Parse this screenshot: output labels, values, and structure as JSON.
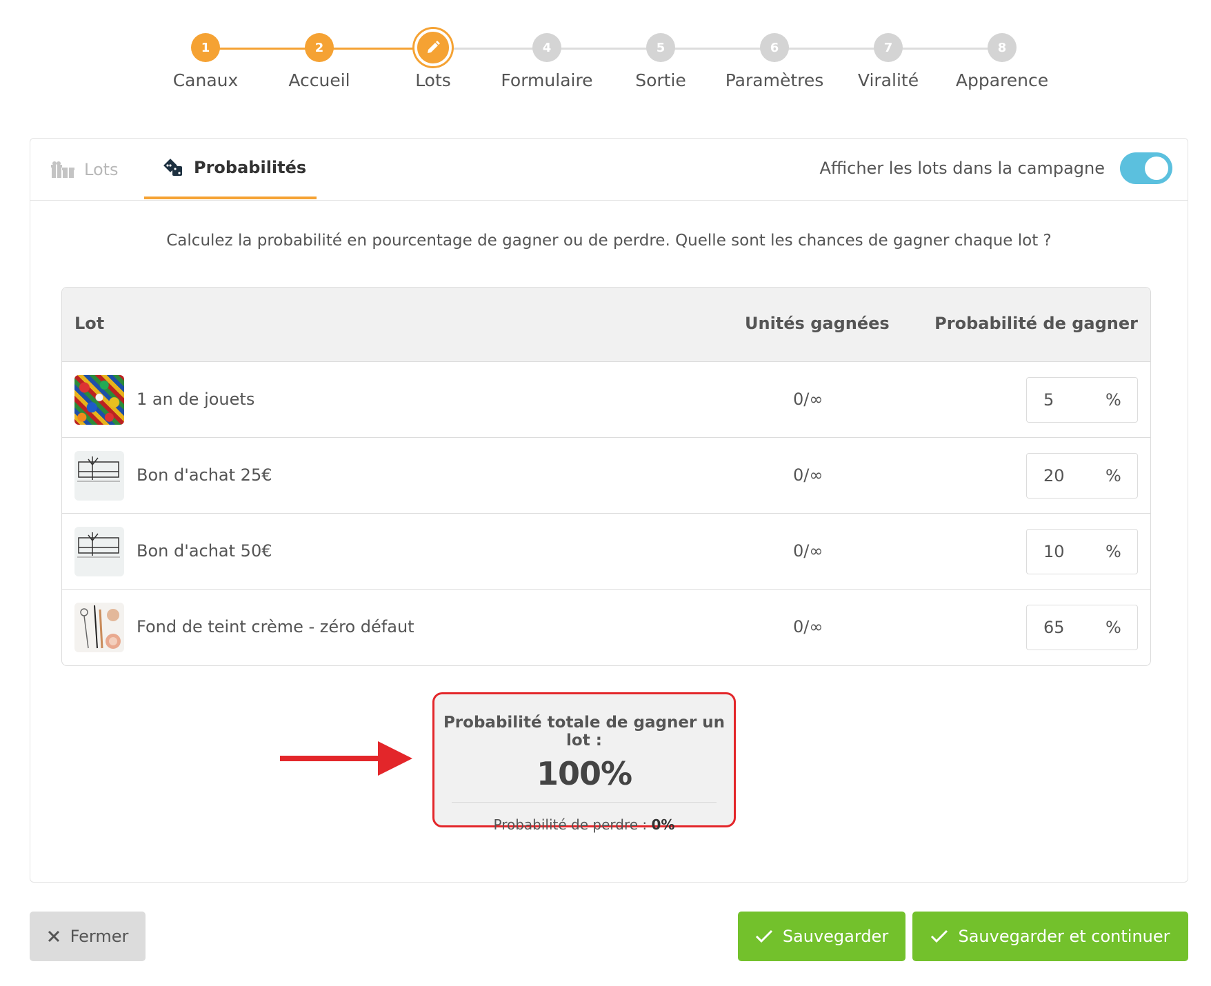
{
  "stepper": {
    "steps": [
      {
        "number": "1",
        "label": "Canaux",
        "state": "done"
      },
      {
        "number": "2",
        "label": "Accueil",
        "state": "done"
      },
      {
        "number": "",
        "label": "Lots",
        "state": "current",
        "icon": "pencil-icon"
      },
      {
        "number": "4",
        "label": "Formulaire",
        "state": "todo"
      },
      {
        "number": "5",
        "label": "Sortie",
        "state": "todo"
      },
      {
        "number": "6",
        "label": "Paramètres",
        "state": "todo"
      },
      {
        "number": "7",
        "label": "Viralité",
        "state": "todo"
      },
      {
        "number": "8",
        "label": "Apparence",
        "state": "todo"
      }
    ]
  },
  "tabs": {
    "lots": {
      "label": "Lots",
      "icon": "gift-icon"
    },
    "probabilities": {
      "label": "Probabilités",
      "icon": "dice-icon"
    }
  },
  "toggle": {
    "label": "Afficher les lots dans la campagne",
    "on": true
  },
  "intro": "Calculez la probabilité en pourcentage de gagner ou de perdre. Quelle sont les chances de gagner chaque lot ?",
  "table": {
    "headers": {
      "lot": "Lot",
      "units": "Unités gagnées",
      "probability": "Probabilité de gagner"
    },
    "rows": [
      {
        "name": "1 an de jouets",
        "units": "0/∞",
        "probability": "5",
        "unit": "%"
      },
      {
        "name": "Bon d'achat 25€",
        "units": "0/∞",
        "probability": "20",
        "unit": "%"
      },
      {
        "name": "Bon d'achat 50€",
        "units": "0/∞",
        "probability": "10",
        "unit": "%"
      },
      {
        "name": "Fond de teint crème - zéro défaut",
        "units": "0/∞",
        "probability": "65",
        "unit": "%"
      }
    ]
  },
  "total": {
    "title": "Probabilité totale de gagner un lot :",
    "value": "100%",
    "lose_label": "Probabilité de perdre :",
    "lose_value": "0%"
  },
  "buttons": {
    "close": "Fermer",
    "save": "Sauvegarder",
    "save_continue": "Sauvegarder et continuer"
  },
  "colors": {
    "accent": "#f5a233",
    "toggle": "#5bc0de",
    "save": "#73c12c",
    "highlight": "#e3262a"
  }
}
